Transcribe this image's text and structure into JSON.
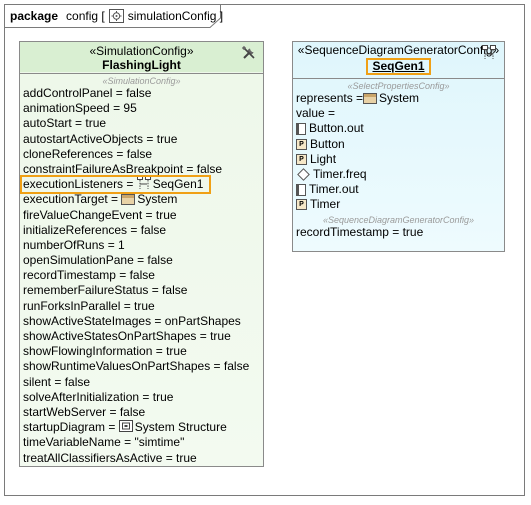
{
  "frame": {
    "keyword": "package",
    "name": "config",
    "diagram_name": "simulationConfig"
  },
  "sim_block": {
    "stereotype": "«SimulationConfig»",
    "name": "FlashingLight",
    "section_stereotype": "«SimulationConfig»",
    "icon": "tools-icon",
    "properties": [
      {
        "label": "addControlPanel = false"
      },
      {
        "label": "animationSpeed = 95"
      },
      {
        "label": "autoStart = true"
      },
      {
        "label": "autostartActiveObjects = true"
      },
      {
        "label": "cloneReferences = false"
      },
      {
        "label": "constraintFailureAsBreakpoint = false"
      },
      {
        "label": "executionListeners = ",
        "ref": "SeqGen1",
        "ref_icon": "sequence-generator-icon",
        "highlighted": true
      },
      {
        "label": "executionTarget = ",
        "ref": "System",
        "ref_icon": "block-icon"
      },
      {
        "label": "fireValueChangeEvent = true"
      },
      {
        "label": "initializeReferences = false"
      },
      {
        "label": "numberOfRuns = 1"
      },
      {
        "label": "openSimulationPane = false"
      },
      {
        "label": "recordTimestamp = false"
      },
      {
        "label": "rememberFailureStatus = false"
      },
      {
        "label": "runForksInParallel = true"
      },
      {
        "label": "showActiveStateImages = onPartShapes"
      },
      {
        "label": "showActiveStatesOnPartShapes = true"
      },
      {
        "label": "showFlowingInformation = true"
      },
      {
        "label": "showRuntimeValuesOnPartShapes = false"
      },
      {
        "label": "silent = false"
      },
      {
        "label": "solveAfterInitialization = true"
      },
      {
        "label": "startWebServer = false"
      },
      {
        "label": "startupDiagram = ",
        "ref": "System Structure",
        "ref_icon": "diagram-icon"
      },
      {
        "label": "timeVariableName = \"simtime\""
      },
      {
        "label": "treatAllClassifiersAsActive = true"
      }
    ]
  },
  "seq_block": {
    "stereotype": "«SequenceDiagramGeneratorConfig»",
    "name": "SeqGen1",
    "icon": "sequence-generator-icon",
    "section_stereotype_1": "«SelectPropertiesConfig»",
    "represents_label": "represents = ",
    "represents_value": "System",
    "value_label": "value =",
    "values": [
      {
        "text": "Button.out",
        "icon": "port-icon"
      },
      {
        "text": "Button",
        "icon": "part-icon"
      },
      {
        "text": "Light",
        "icon": "part-icon"
      },
      {
        "text": "Timer.freq",
        "icon": "signal-icon"
      },
      {
        "text": "Timer.out",
        "icon": "port-icon"
      },
      {
        "text": "Timer",
        "icon": "part-icon"
      }
    ],
    "section_stereotype_2": "«SequenceDiagramGeneratorConfig»",
    "record_label": "recordTimestamp = true"
  }
}
